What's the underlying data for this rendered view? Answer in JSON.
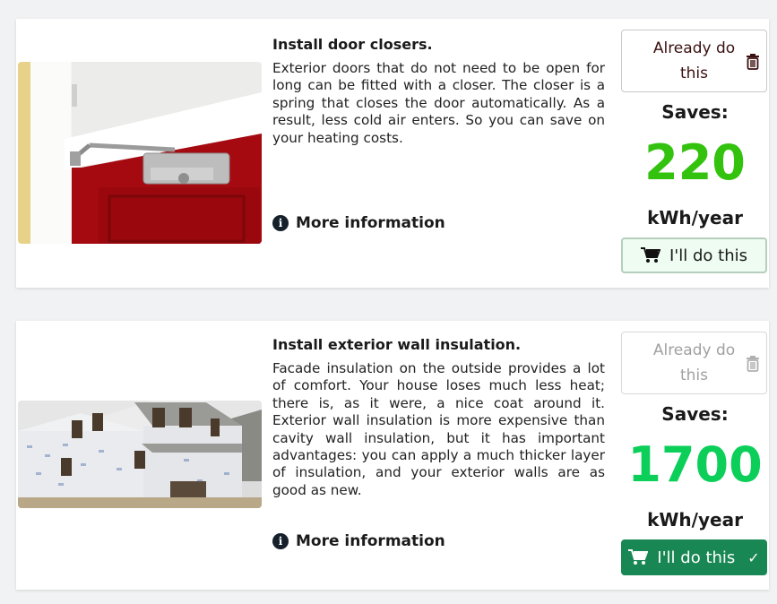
{
  "measures": [
    {
      "title": "Install door closers.",
      "description": "Exterior doors that do not need to be open for long can be fitted with a closer. The closer is a spring that closes the door automatically. As a result, less cold air enters. So you can save on your heating costs.",
      "more_label": "More information",
      "already_label": "Already do this",
      "saves_label": "Saves:",
      "value": "220",
      "unit": "kWh/year",
      "action_label": "I'll do this",
      "value_color": "#33c20e",
      "selected": false
    },
    {
      "title": "Install exterior wall insulation.",
      "description": "Facade insulation on the outside provides a lot of comfort. Your house loses much less heat; there is, as it were, a nice coat around it. Exterior wall insulation is more expensive than cavity wall insulation, but it has important advantages: you can apply a much thicker layer of insulation, and your exterior walls are as good as new.",
      "more_label": "More information",
      "already_label": "Already do this",
      "saves_label": "Saves:",
      "value": "1700",
      "unit": "kWh/year",
      "action_label": "I'll do this",
      "action_check": "✓",
      "value_color": "#0ccf5a",
      "selected": true
    }
  ]
}
